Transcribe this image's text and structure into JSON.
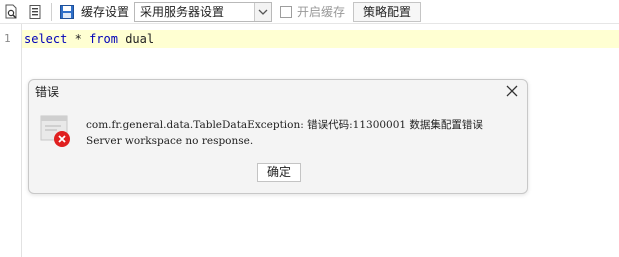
{
  "toolbar": {
    "cache_settings_label": "缓存设置",
    "cache_mode_value": "采用服务器设置",
    "enable_cache_label": "开启缓存",
    "enable_cache_checked": false,
    "policy_button_label": "策略配置"
  },
  "editor": {
    "line_number": "1",
    "tokens": [
      "select",
      "*",
      "from",
      "dual"
    ]
  },
  "dialog": {
    "title": "错误",
    "message_line1": "com.fr.general.data.TableDataException: 错误代码:11300001 数据集配置错误",
    "message_line2": "Server workspace no response.",
    "ok_label": "确定"
  },
  "colors": {
    "keyword": "#0000b8",
    "current_line": "#ffffd2",
    "error_red": "#e02020"
  }
}
